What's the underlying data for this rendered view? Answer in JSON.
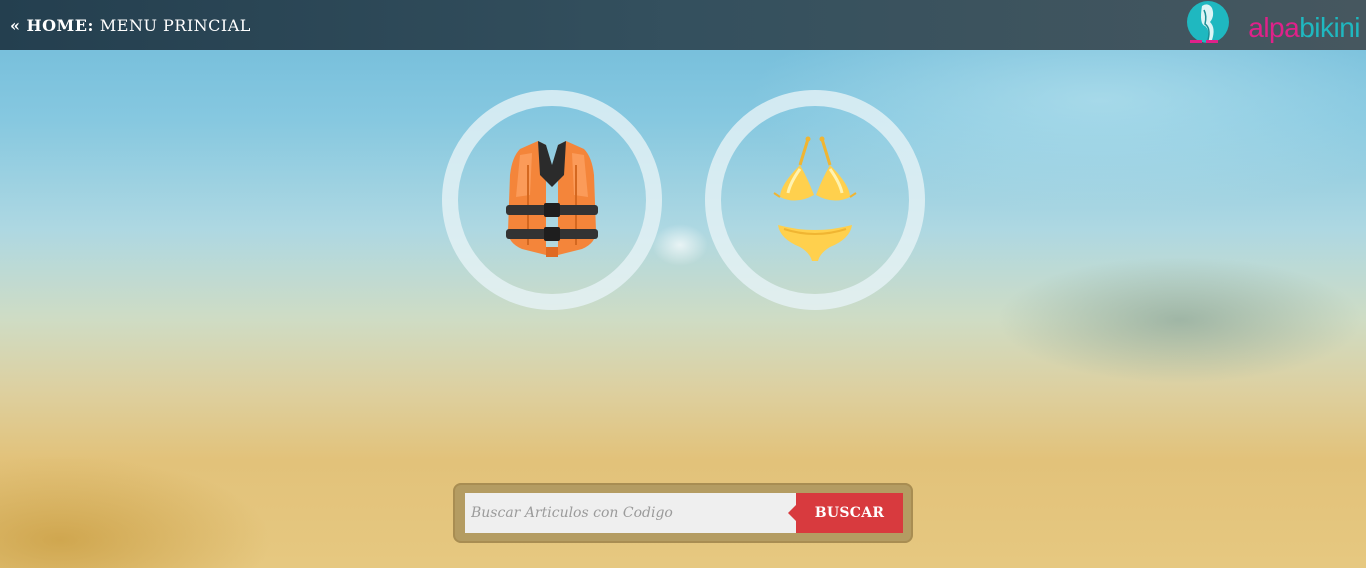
{
  "header": {
    "back_glyph": "«",
    "home_label": "HOME:",
    "section_label": "MENU PRINCIAL",
    "logo": {
      "text_part1": "alpa",
      "text_part2": "bikini",
      "color_pink": "#e0218a",
      "color_teal": "#1fb8c0"
    }
  },
  "menu": {
    "items": [
      {
        "icon": "life-vest-icon"
      },
      {
        "icon": "bikini-icon"
      }
    ]
  },
  "search": {
    "placeholder": "Buscar Articulos con Codigo",
    "value": "",
    "button_label": "BUSCAR",
    "button_color": "#d83a3e"
  }
}
